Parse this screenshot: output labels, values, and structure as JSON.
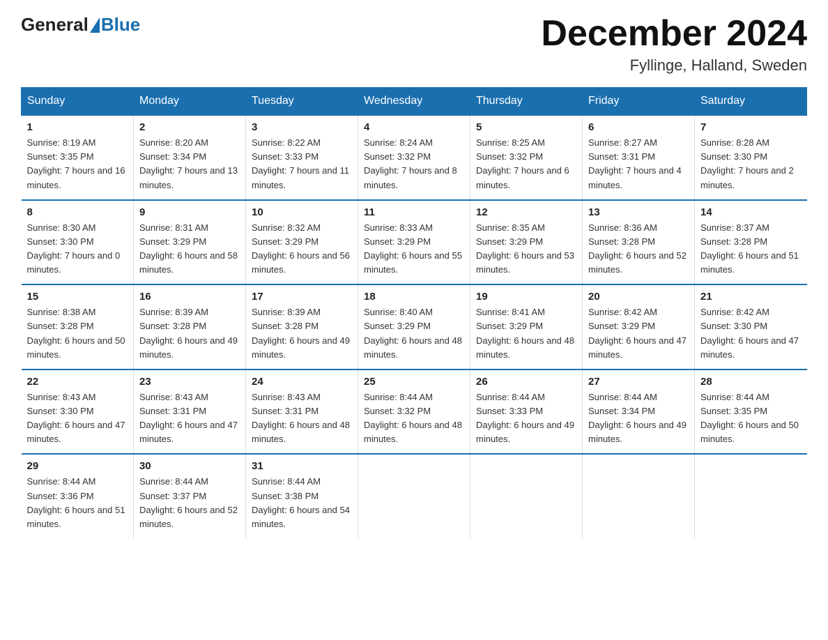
{
  "header": {
    "logo_general": "General",
    "logo_blue": "Blue",
    "month_title": "December 2024",
    "location": "Fyllinge, Halland, Sweden"
  },
  "weekdays": [
    "Sunday",
    "Monday",
    "Tuesday",
    "Wednesday",
    "Thursday",
    "Friday",
    "Saturday"
  ],
  "weeks": [
    [
      {
        "day": "1",
        "sunrise": "Sunrise: 8:19 AM",
        "sunset": "Sunset: 3:35 PM",
        "daylight": "Daylight: 7 hours and 16 minutes."
      },
      {
        "day": "2",
        "sunrise": "Sunrise: 8:20 AM",
        "sunset": "Sunset: 3:34 PM",
        "daylight": "Daylight: 7 hours and 13 minutes."
      },
      {
        "day": "3",
        "sunrise": "Sunrise: 8:22 AM",
        "sunset": "Sunset: 3:33 PM",
        "daylight": "Daylight: 7 hours and 11 minutes."
      },
      {
        "day": "4",
        "sunrise": "Sunrise: 8:24 AM",
        "sunset": "Sunset: 3:32 PM",
        "daylight": "Daylight: 7 hours and 8 minutes."
      },
      {
        "day": "5",
        "sunrise": "Sunrise: 8:25 AM",
        "sunset": "Sunset: 3:32 PM",
        "daylight": "Daylight: 7 hours and 6 minutes."
      },
      {
        "day": "6",
        "sunrise": "Sunrise: 8:27 AM",
        "sunset": "Sunset: 3:31 PM",
        "daylight": "Daylight: 7 hours and 4 minutes."
      },
      {
        "day": "7",
        "sunrise": "Sunrise: 8:28 AM",
        "sunset": "Sunset: 3:30 PM",
        "daylight": "Daylight: 7 hours and 2 minutes."
      }
    ],
    [
      {
        "day": "8",
        "sunrise": "Sunrise: 8:30 AM",
        "sunset": "Sunset: 3:30 PM",
        "daylight": "Daylight: 7 hours and 0 minutes."
      },
      {
        "day": "9",
        "sunrise": "Sunrise: 8:31 AM",
        "sunset": "Sunset: 3:29 PM",
        "daylight": "Daylight: 6 hours and 58 minutes."
      },
      {
        "day": "10",
        "sunrise": "Sunrise: 8:32 AM",
        "sunset": "Sunset: 3:29 PM",
        "daylight": "Daylight: 6 hours and 56 minutes."
      },
      {
        "day": "11",
        "sunrise": "Sunrise: 8:33 AM",
        "sunset": "Sunset: 3:29 PM",
        "daylight": "Daylight: 6 hours and 55 minutes."
      },
      {
        "day": "12",
        "sunrise": "Sunrise: 8:35 AM",
        "sunset": "Sunset: 3:29 PM",
        "daylight": "Daylight: 6 hours and 53 minutes."
      },
      {
        "day": "13",
        "sunrise": "Sunrise: 8:36 AM",
        "sunset": "Sunset: 3:28 PM",
        "daylight": "Daylight: 6 hours and 52 minutes."
      },
      {
        "day": "14",
        "sunrise": "Sunrise: 8:37 AM",
        "sunset": "Sunset: 3:28 PM",
        "daylight": "Daylight: 6 hours and 51 minutes."
      }
    ],
    [
      {
        "day": "15",
        "sunrise": "Sunrise: 8:38 AM",
        "sunset": "Sunset: 3:28 PM",
        "daylight": "Daylight: 6 hours and 50 minutes."
      },
      {
        "day": "16",
        "sunrise": "Sunrise: 8:39 AM",
        "sunset": "Sunset: 3:28 PM",
        "daylight": "Daylight: 6 hours and 49 minutes."
      },
      {
        "day": "17",
        "sunrise": "Sunrise: 8:39 AM",
        "sunset": "Sunset: 3:28 PM",
        "daylight": "Daylight: 6 hours and 49 minutes."
      },
      {
        "day": "18",
        "sunrise": "Sunrise: 8:40 AM",
        "sunset": "Sunset: 3:29 PM",
        "daylight": "Daylight: 6 hours and 48 minutes."
      },
      {
        "day": "19",
        "sunrise": "Sunrise: 8:41 AM",
        "sunset": "Sunset: 3:29 PM",
        "daylight": "Daylight: 6 hours and 48 minutes."
      },
      {
        "day": "20",
        "sunrise": "Sunrise: 8:42 AM",
        "sunset": "Sunset: 3:29 PM",
        "daylight": "Daylight: 6 hours and 47 minutes."
      },
      {
        "day": "21",
        "sunrise": "Sunrise: 8:42 AM",
        "sunset": "Sunset: 3:30 PM",
        "daylight": "Daylight: 6 hours and 47 minutes."
      }
    ],
    [
      {
        "day": "22",
        "sunrise": "Sunrise: 8:43 AM",
        "sunset": "Sunset: 3:30 PM",
        "daylight": "Daylight: 6 hours and 47 minutes."
      },
      {
        "day": "23",
        "sunrise": "Sunrise: 8:43 AM",
        "sunset": "Sunset: 3:31 PM",
        "daylight": "Daylight: 6 hours and 47 minutes."
      },
      {
        "day": "24",
        "sunrise": "Sunrise: 8:43 AM",
        "sunset": "Sunset: 3:31 PM",
        "daylight": "Daylight: 6 hours and 48 minutes."
      },
      {
        "day": "25",
        "sunrise": "Sunrise: 8:44 AM",
        "sunset": "Sunset: 3:32 PM",
        "daylight": "Daylight: 6 hours and 48 minutes."
      },
      {
        "day": "26",
        "sunrise": "Sunrise: 8:44 AM",
        "sunset": "Sunset: 3:33 PM",
        "daylight": "Daylight: 6 hours and 49 minutes."
      },
      {
        "day": "27",
        "sunrise": "Sunrise: 8:44 AM",
        "sunset": "Sunset: 3:34 PM",
        "daylight": "Daylight: 6 hours and 49 minutes."
      },
      {
        "day": "28",
        "sunrise": "Sunrise: 8:44 AM",
        "sunset": "Sunset: 3:35 PM",
        "daylight": "Daylight: 6 hours and 50 minutes."
      }
    ],
    [
      {
        "day": "29",
        "sunrise": "Sunrise: 8:44 AM",
        "sunset": "Sunset: 3:36 PM",
        "daylight": "Daylight: 6 hours and 51 minutes."
      },
      {
        "day": "30",
        "sunrise": "Sunrise: 8:44 AM",
        "sunset": "Sunset: 3:37 PM",
        "daylight": "Daylight: 6 hours and 52 minutes."
      },
      {
        "day": "31",
        "sunrise": "Sunrise: 8:44 AM",
        "sunset": "Sunset: 3:38 PM",
        "daylight": "Daylight: 6 hours and 54 minutes."
      },
      null,
      null,
      null,
      null
    ]
  ]
}
